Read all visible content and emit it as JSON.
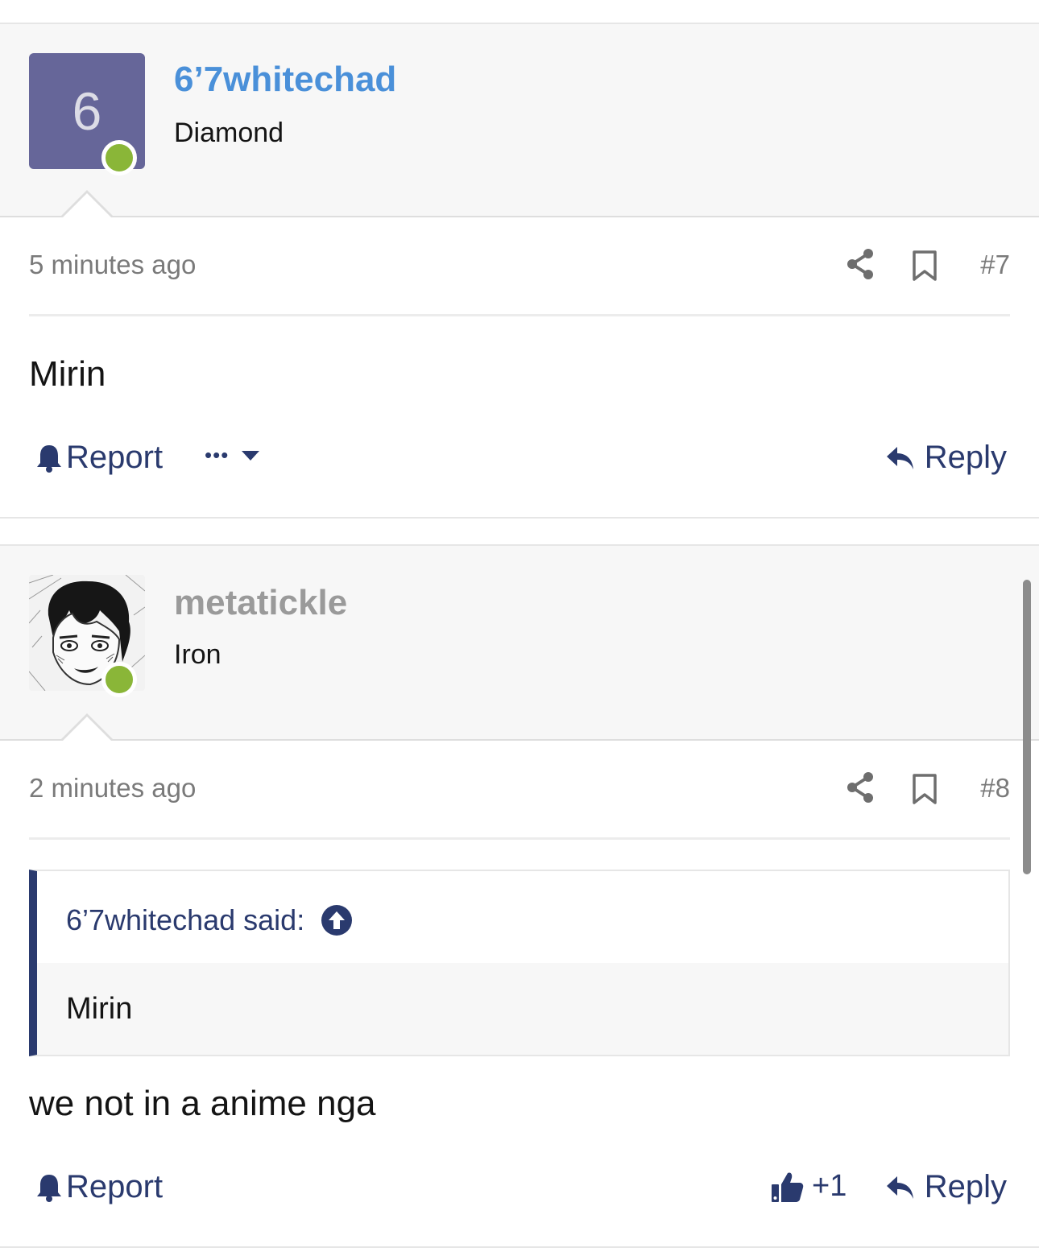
{
  "posts": [
    {
      "avatar_letter": "6",
      "username": "6’7whitechad",
      "username_color": "#4a90d9",
      "user_title": "Diamond",
      "timestamp": "5 minutes ago",
      "post_number": "#7",
      "body": "Mirin",
      "actions": {
        "report": "Report",
        "more": "•••",
        "reply": "Reply"
      }
    },
    {
      "avatar_image": "anime-avatar",
      "username": "metatickle",
      "username_color": "#9a9a9a",
      "user_title": "Iron",
      "timestamp": "2 minutes ago",
      "post_number": "#8",
      "quote": {
        "attribution": "6’7whitechad said:",
        "text": "Mirin"
      },
      "body": "we not in a anime nga",
      "actions": {
        "report": "Report",
        "like_count": "+1",
        "reply": "Reply"
      }
    }
  ],
  "colors": {
    "accent": "#2a3a6e",
    "online": "#8ab638",
    "avatar_bg": "#666699",
    "header_bg": "#f7f7f7",
    "muted_text": "#7a7a7a"
  },
  "icons": [
    "bell-icon",
    "share-icon",
    "bookmark-icon",
    "reply-arrow-icon",
    "thumbs-up-icon",
    "up-arrow-circle-icon",
    "dropdown-caret-icon"
  ]
}
